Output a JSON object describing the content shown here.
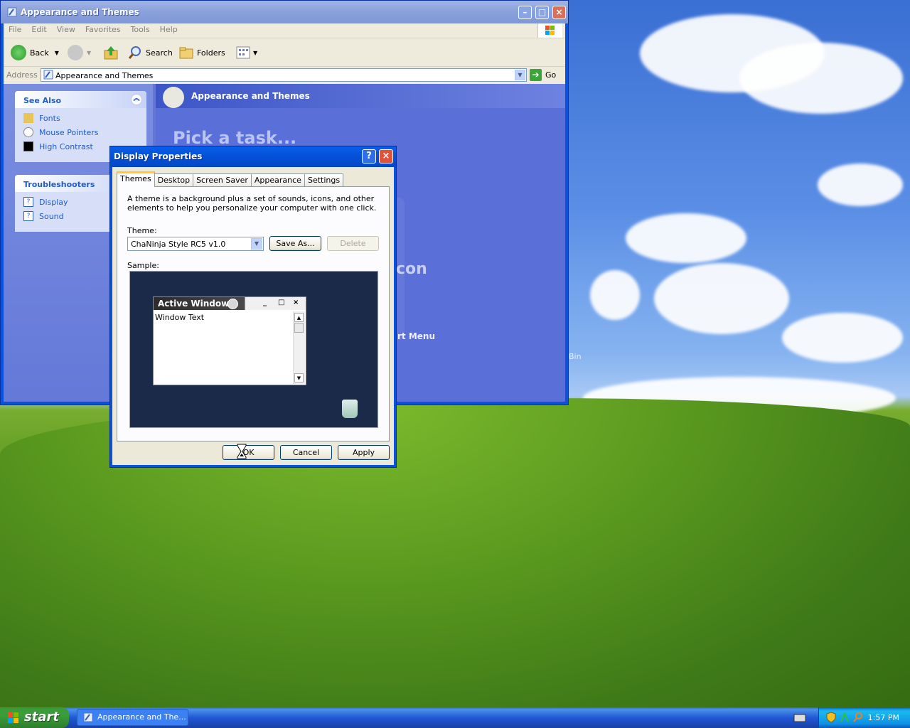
{
  "explorer": {
    "title": "Appearance and Themes",
    "menu": [
      "File",
      "Edit",
      "View",
      "Favorites",
      "Tools",
      "Help"
    ],
    "toolbar": {
      "back": "Back",
      "search": "Search",
      "folders": "Folders"
    },
    "address": {
      "label": "Address",
      "value": "Appearance and Themes",
      "go": "Go"
    },
    "see_also": {
      "title": "See Also",
      "items": [
        "Fonts",
        "Mouse Pointers",
        "High Contrast"
      ]
    },
    "troubleshooters": {
      "title": "Troubleshooters",
      "items": [
        "Display",
        "Sound"
      ]
    },
    "panel_title": "Appearance and Themes",
    "pick_task": "Pick a task...",
    "faint_text_1": "con",
    "faint_text_2": "rt Menu"
  },
  "desktop": {
    "recycle_bin_partial": "Bin"
  },
  "dialog": {
    "title": "Display Properties",
    "tabs": [
      "Themes",
      "Desktop",
      "Screen Saver",
      "Appearance",
      "Settings"
    ],
    "description": "A theme is a background plus a set of sounds, icons, and other elements to help you personalize your computer with one click.",
    "theme_label": "Theme:",
    "theme_value": "ChaNinja Style RC5 v1.0",
    "save_as": "Save As...",
    "delete": "Delete",
    "sample_label": "Sample:",
    "sample": {
      "active_window": "Active Window",
      "window_text": "Window Text"
    },
    "buttons": {
      "ok": "OK",
      "cancel": "Cancel",
      "apply": "Apply"
    }
  },
  "taskbar": {
    "start": "start",
    "task": "Appearance and The...",
    "clock": "1:57 PM"
  }
}
